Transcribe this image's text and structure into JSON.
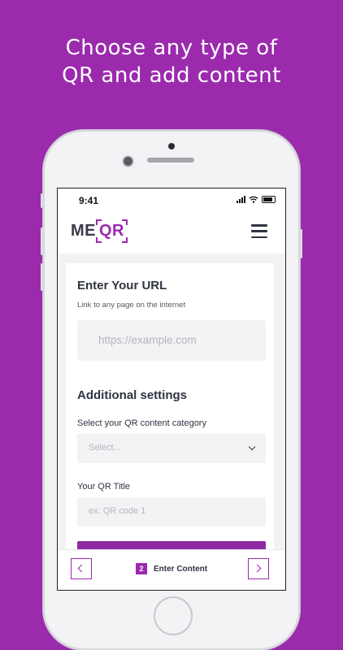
{
  "headline": {
    "line1": "Choose any type of",
    "line2": "QR and add content"
  },
  "status_bar": {
    "time": "9:41",
    "icons": [
      "signal-icon",
      "wifi-icon",
      "battery-icon"
    ]
  },
  "app": {
    "logo_me": "ME",
    "logo_qr": "QR",
    "menu_icon": "hamburger-menu-icon"
  },
  "url_section": {
    "title": "Enter Your URL",
    "subtitle": "Link to any page on the internet",
    "url_placeholder": "https://example.com"
  },
  "settings": {
    "title": "Additional settings",
    "category_label": "Select your QR content category",
    "category_selected": "Select...",
    "qr_title_label": "Your QR Title",
    "qr_title_placeholder": "ex. QR code 1"
  },
  "footer": {
    "step_number": "2",
    "step_label": "Enter Content",
    "prev_icon": "chevron-left-icon",
    "next_icon": "chevron-right-icon"
  },
  "colors": {
    "background": "#9b2aad",
    "accent": "#9b2aad",
    "text_dark": "#2f3342"
  }
}
